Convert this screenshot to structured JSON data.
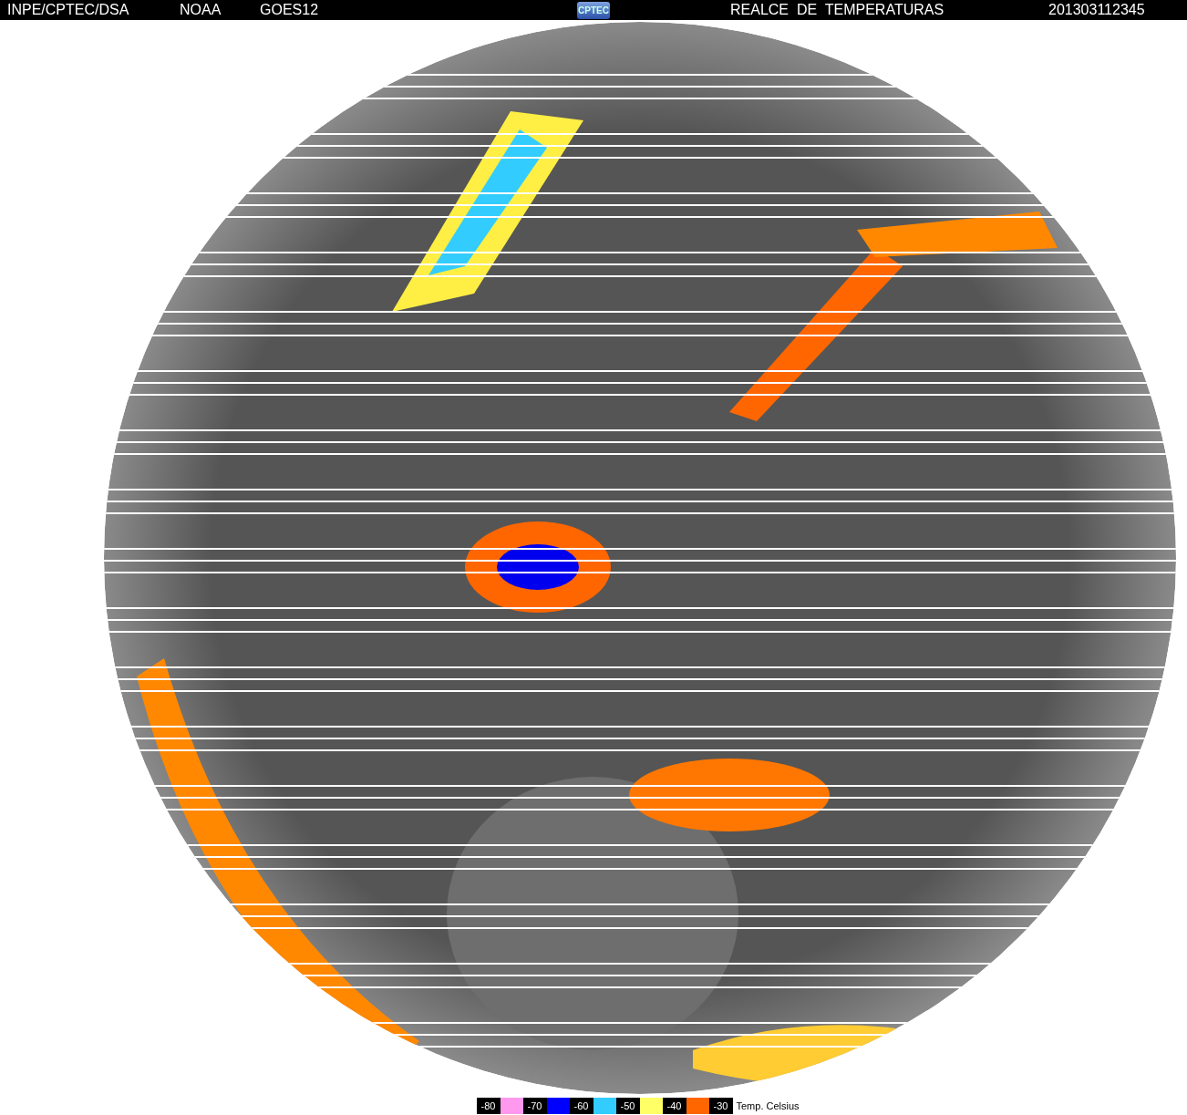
{
  "header": {
    "source": "INPE/CPTEC/DSA",
    "agency": "NOAA",
    "satellite": "GOES12",
    "logo": "CPTEC",
    "product": "REALCE  DE  TEMPERATURAS",
    "timestamp": "201303112345"
  },
  "legend": {
    "labels": [
      "-80",
      "-70",
      "-60",
      "-50",
      "-40",
      "-30"
    ],
    "swatches": [
      {
        "color": "#ff99ee"
      },
      {
        "color": "#0000ff"
      },
      {
        "color": "#33ccff"
      },
      {
        "color": "#ffff66"
      },
      {
        "color": "#ff6600"
      }
    ],
    "caption": "Temp. Celsius"
  }
}
